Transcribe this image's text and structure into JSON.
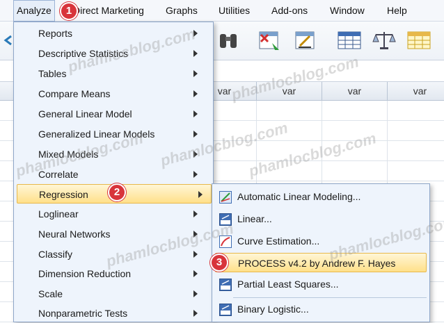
{
  "menubar": {
    "items": [
      {
        "label": "Analyze"
      },
      {
        "label": "Direct Marketing"
      },
      {
        "label": "Graphs"
      },
      {
        "label": "Utilities"
      },
      {
        "label": "Add-ons"
      },
      {
        "label": "Window"
      },
      {
        "label": "Help"
      }
    ]
  },
  "grid": {
    "columns": [
      "var",
      "var",
      "var",
      "var"
    ]
  },
  "analyze_menu": {
    "items": [
      {
        "label": "Reports"
      },
      {
        "label": "Descriptive Statistics"
      },
      {
        "label": "Tables"
      },
      {
        "label": "Compare Means"
      },
      {
        "label": "General Linear Model"
      },
      {
        "label": "Generalized Linear Models"
      },
      {
        "label": "Mixed Models"
      },
      {
        "label": "Correlate"
      },
      {
        "label": "Regression"
      },
      {
        "label": "Loglinear"
      },
      {
        "label": "Neural Networks"
      },
      {
        "label": "Classify"
      },
      {
        "label": "Dimension Reduction"
      },
      {
        "label": "Scale"
      },
      {
        "label": "Nonparametric Tests"
      }
    ],
    "highlighted": "Regression"
  },
  "regression_submenu": {
    "items": [
      {
        "label": "Automatic Linear Modeling...",
        "icon": "automatic-linear-icon"
      },
      {
        "label": "Linear...",
        "icon": "linear-icon"
      },
      {
        "label": "Curve Estimation...",
        "icon": "curve-estimation-icon"
      },
      {
        "label": "PROCESS v4.2 by Andrew F. Hayes",
        "icon": "none"
      },
      {
        "label": "Partial Least Squares...",
        "icon": "pls-icon"
      },
      {
        "label": "Binary Logistic...",
        "icon": "binary-logistic-icon"
      }
    ],
    "highlighted": "PROCESS v4.2 by Andrew F. Hayes"
  },
  "callouts": [
    "1",
    "2",
    "3"
  ],
  "watermark": "phamlocblog.com",
  "colors": {
    "menu_bg": "#eef4fc",
    "highlight": "#ffe08a",
    "badge": "#d8343b"
  }
}
